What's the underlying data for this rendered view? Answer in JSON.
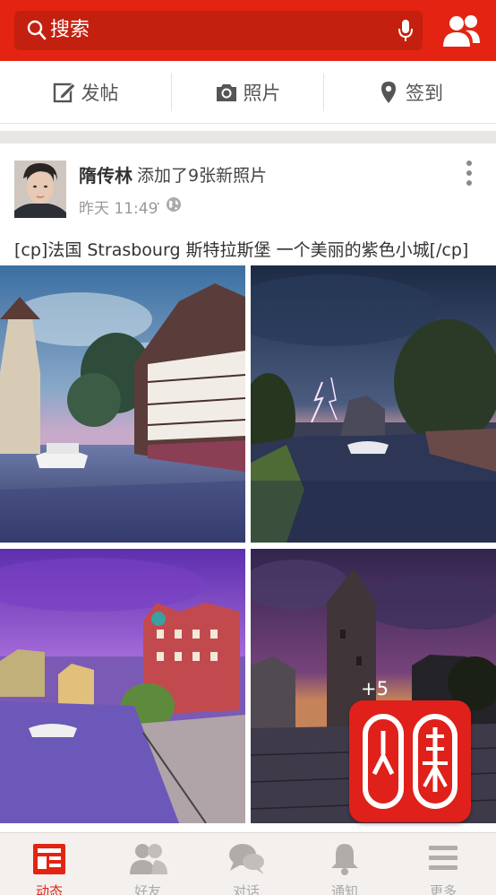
{
  "header": {
    "search_placeholder": "搜索",
    "search_icon": "search-icon",
    "mic_icon": "microphone-icon",
    "contacts_icon": "add-contact-icon",
    "brand_color": "#e32412"
  },
  "actions": [
    {
      "label": "发帖",
      "icon": "edit-icon"
    },
    {
      "label": "照片",
      "icon": "camera-icon"
    },
    {
      "label": "签到",
      "icon": "location-pin-icon"
    }
  ],
  "post": {
    "author": "隋传林",
    "action": "添加了9张新照片",
    "time": "昨天 11:49",
    "separator": "·",
    "text": "[cp]法国 Strasbourg 斯特拉斯堡 一个美丽的紫色小城[/cp]",
    "extra_photos": "+5"
  },
  "watermark": {
    "icon": "guoguo-logo"
  },
  "tabs": [
    {
      "label": "动态",
      "icon": "feed-icon",
      "active": true
    },
    {
      "label": "好友",
      "icon": "friends-icon",
      "active": false
    },
    {
      "label": "对话",
      "icon": "chat-icon",
      "active": false
    },
    {
      "label": "通知",
      "icon": "bell-icon",
      "active": false
    },
    {
      "label": "更多",
      "icon": "menu-icon",
      "active": false
    }
  ]
}
